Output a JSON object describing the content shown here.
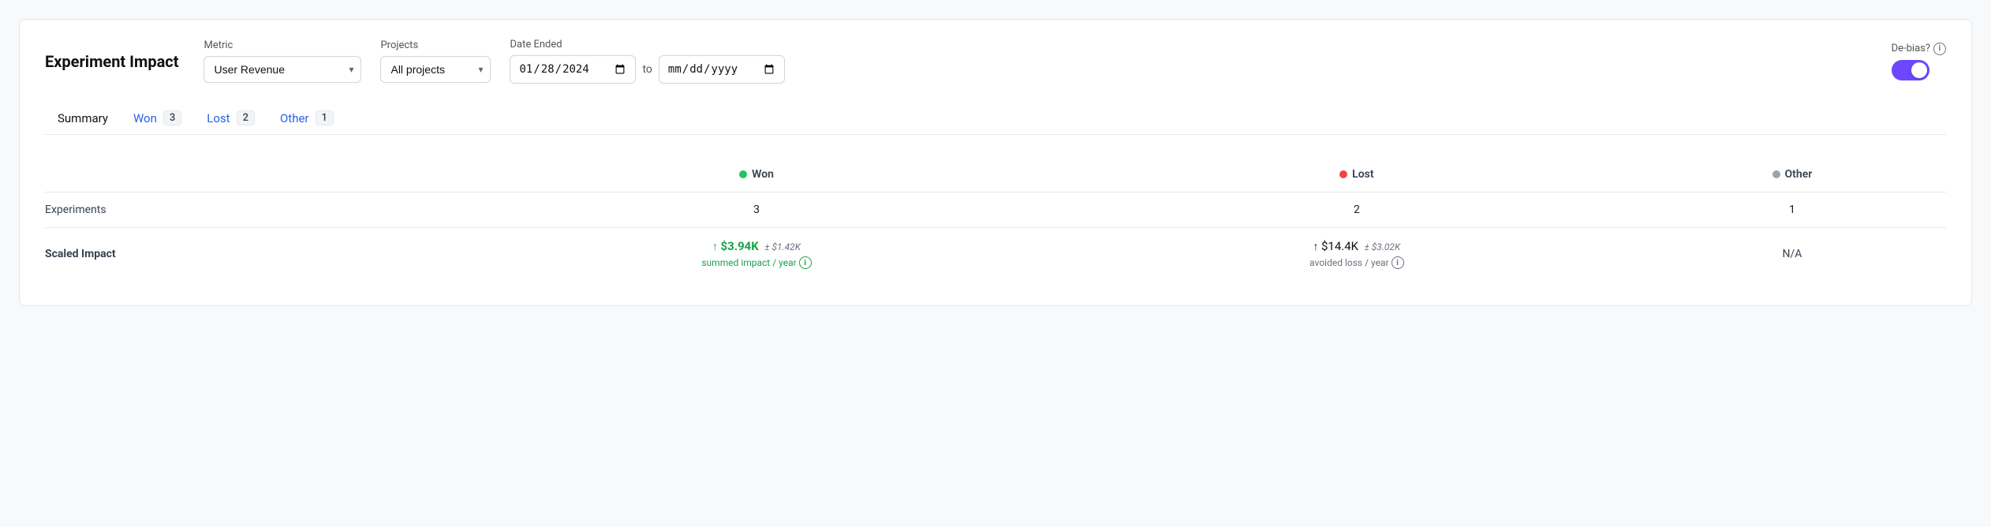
{
  "page": {
    "title": "Experiment Impact"
  },
  "controls": {
    "metric_label": "Metric",
    "metric_value": "User Revenue",
    "projects_label": "Projects",
    "projects_value": "All projects",
    "date_label": "Date Ended",
    "date_from": "01/28/2024",
    "date_to": "mm/dd/yyyy",
    "date_separator": "to",
    "debias_label": "De-bias?",
    "debias_checked": true
  },
  "tabs": [
    {
      "label": "Summary",
      "badge": null,
      "active": true,
      "color": "gray"
    },
    {
      "label": "Won",
      "badge": "3",
      "active": false,
      "color": "blue"
    },
    {
      "label": "Lost",
      "badge": "2",
      "active": false,
      "color": "blue"
    },
    {
      "label": "Other",
      "badge": "1",
      "active": false,
      "color": "blue"
    }
  ],
  "table": {
    "columns": [
      {
        "label": "",
        "dot": null
      },
      {
        "label": "Won",
        "dot": "green"
      },
      {
        "label": "Lost",
        "dot": "red"
      },
      {
        "label": "Other",
        "dot": "gray"
      }
    ],
    "rows": [
      {
        "label": "Experiments",
        "bold": false,
        "cells": [
          "3",
          "2",
          "1"
        ]
      },
      {
        "label": "Scaled Impact",
        "bold": true,
        "cells": [
          {
            "type": "impact-green",
            "arrow": "↑",
            "amount": "$3.94K",
            "margin": "± $1.42K",
            "sub_label": "summed impact / year",
            "sub_color": "green"
          },
          {
            "type": "impact-black",
            "arrow": "↑",
            "amount": "$14.4K",
            "margin": "± $3.02K",
            "sub_label": "avoided loss / year",
            "sub_color": "gray"
          },
          {
            "type": "na",
            "value": "N/A"
          }
        ]
      }
    ]
  }
}
